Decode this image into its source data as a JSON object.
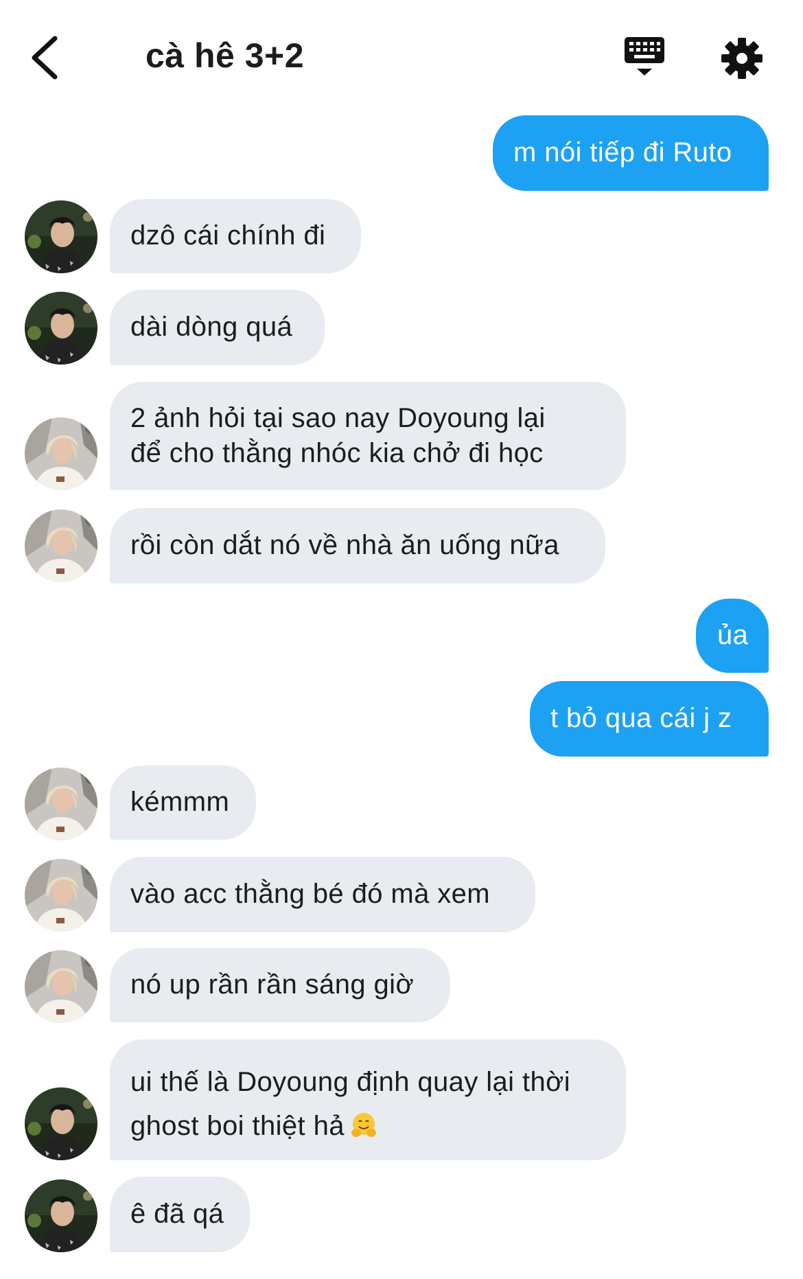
{
  "header": {
    "title": "cà hê 3+2",
    "back_icon": "chevron-left-icon",
    "keyboard_icon": "keyboard-icon",
    "settings_icon": "gear-icon"
  },
  "colors": {
    "outgoing_bubble": "#1da1f2",
    "incoming_bubble": "#e8ebf0"
  },
  "messages": [
    {
      "from": "me",
      "text": "m nói tiếp đi Ruto"
    },
    {
      "from": "user-a",
      "text": "dzô cái chính đi"
    },
    {
      "from": "user-a",
      "text": "dài dòng quá"
    },
    {
      "from": "user-b",
      "lines": [
        "2 ảnh hỏi tại sao nay Doyoung lại",
        "để cho thằng nhóc kia chở đi học"
      ]
    },
    {
      "from": "user-b",
      "text": "rồi còn dắt nó về nhà ăn uống nữa"
    },
    {
      "from": "me",
      "text": "ủa"
    },
    {
      "from": "me",
      "text": "t bỏ qua cái j z"
    },
    {
      "from": "user-b",
      "text": "kémmm"
    },
    {
      "from": "user-b",
      "text": "vào acc thằng bé đó mà xem"
    },
    {
      "from": "user-b",
      "text": "nó up rần rần sáng giờ"
    },
    {
      "from": "user-a",
      "lines": [
        "ui thế là Doyoung định quay lại thời",
        "ghost boi thiệt hả"
      ],
      "emoji": "hugging-face-emoji"
    },
    {
      "from": "user-a",
      "text": "ê đã qá"
    }
  ]
}
